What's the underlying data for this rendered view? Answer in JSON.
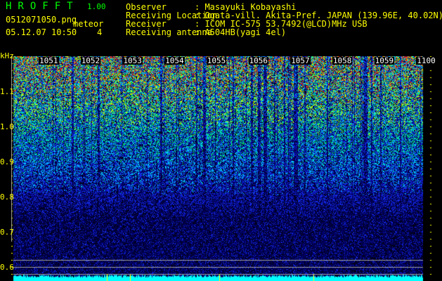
{
  "app": {
    "title": "HROFFT",
    "version": "1.00"
  },
  "file": {
    "name": "0512071050.png",
    "datetime": "05.12.07 10:50"
  },
  "meteor": {
    "label": "meteor",
    "count": "4"
  },
  "info": [
    {
      "key": "Observer",
      "value": "Masayuki Kobayashi"
    },
    {
      "key": "Receiving Location",
      "value": "Ogata-vill. Akita-Pref. JAPAN (139.96E, 40.02N)"
    },
    {
      "key": "Receiver",
      "value": "ICOM IC-575 53.7492(@LCD)MHz USB"
    },
    {
      "key": "Receiving antenna",
      "value": "A504HB(yagi 4el)"
    }
  ],
  "spectrogram": {
    "unit": "kHz",
    "y_ticks": [
      "1.1",
      "1.0",
      "0.9",
      "0.8",
      "0.7",
      "0.6"
    ],
    "time_ticks": [
      "1051",
      "1052",
      "1053",
      "1054",
      "1055",
      "1056",
      "1057",
      "1058",
      "1059",
      "1100"
    ],
    "colors": {
      "low": "#000040",
      "mid": "#0000ff",
      "high": "#00ffff",
      "peak": "#ff0000",
      "signal_bar": "#00ffff",
      "ref_line": "#a0a0a0"
    }
  }
}
